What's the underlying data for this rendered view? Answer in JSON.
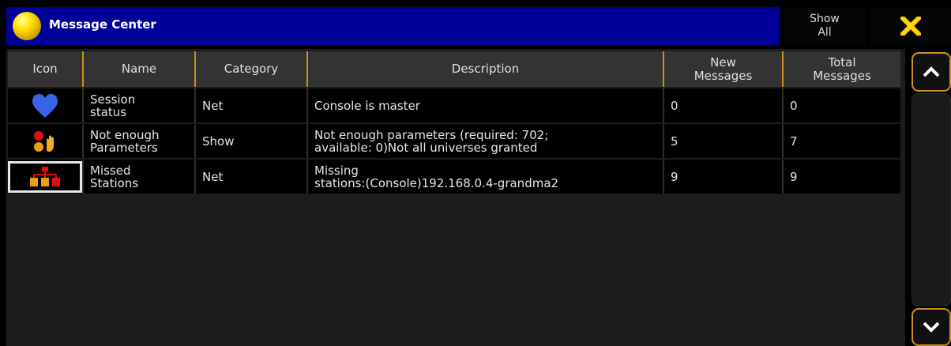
{
  "window": {
    "title": "Message Center",
    "show_all_line1": "Show",
    "show_all_line2": "All",
    "close_icon": "close-x-icon",
    "app_icon": "yellow-orb-icon"
  },
  "colors": {
    "title_bar": "#000099",
    "accent": "#c8921a",
    "header_bg": "#333333",
    "row_bg": "#000000",
    "close_x": "#ffd400"
  },
  "table": {
    "columns": [
      {
        "line1": "Icon",
        "line2": ""
      },
      {
        "line1": "Name",
        "line2": ""
      },
      {
        "line1": "Category",
        "line2": ""
      },
      {
        "line1": "Description",
        "line2": ""
      },
      {
        "line1": "New",
        "line2": "Messages"
      },
      {
        "line1": "Total",
        "line2": "Messages"
      }
    ],
    "rows": [
      {
        "icon": "heart-icon",
        "name_line1": "Session",
        "name_line2": "status",
        "category": "Net",
        "desc_line1": "Console is master",
        "desc_line2": "",
        "new_messages": "0",
        "total_messages": "0"
      },
      {
        "icon": "parameters-icon",
        "name_line1": "Not enough",
        "name_line2": "Parameters",
        "category": "Show",
        "desc_line1": "Not enough parameters (required: 702;",
        "desc_line2": "available: 0)Not all universes granted",
        "new_messages": "5",
        "total_messages": "7"
      },
      {
        "icon": "network-stations-icon",
        "name_line1": "Missed",
        "name_line2": "Stations",
        "category": "Net",
        "desc_line1": "Missing",
        "desc_line2": "stations:(Console)192.168.0.4-grandma2",
        "new_messages": "9",
        "total_messages": "9"
      }
    ]
  },
  "scrollbar": {
    "up_icon": "chevron-up-icon",
    "down_icon": "chevron-down-icon"
  }
}
